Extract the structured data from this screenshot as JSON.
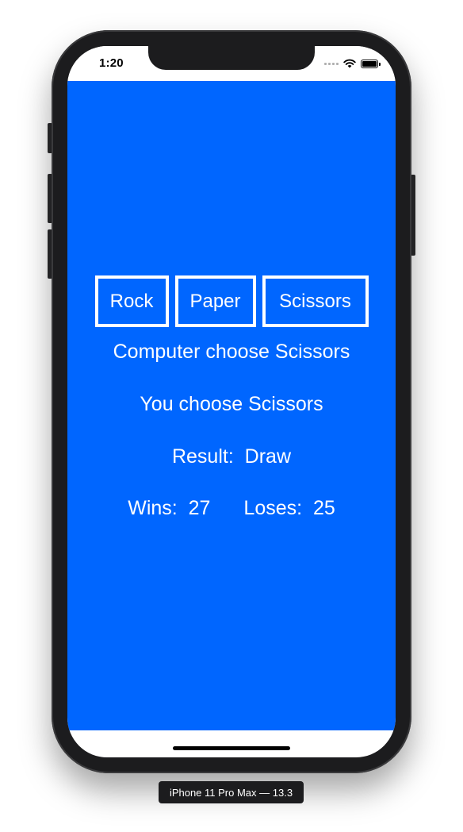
{
  "status_bar": {
    "time": "1:20",
    "icons": [
      "cellular-signal-icon",
      "wifi-icon",
      "battery-icon"
    ]
  },
  "app": {
    "background_color": "#0066ff",
    "buttons": {
      "rock": "Rock",
      "paper": "Paper",
      "scissors": "Scissors"
    },
    "computer_choice": "Computer choose Scissors",
    "user_choice": "You choose Scissors",
    "result": "Result:  Draw",
    "wins": "Wins:  27",
    "loses": "Loses:  25"
  },
  "device": {
    "label": "iPhone 11 Pro Max — 13.3"
  }
}
